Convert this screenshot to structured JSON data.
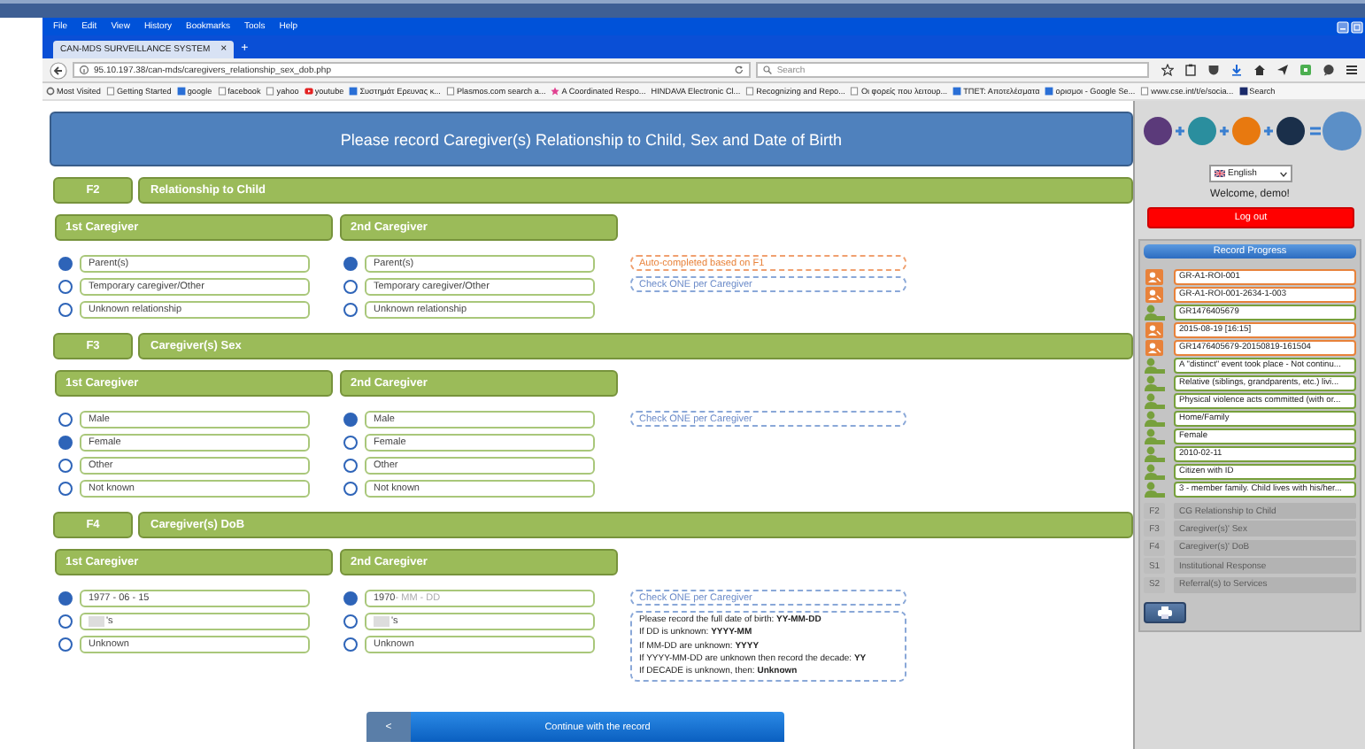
{
  "browser": {
    "menu": [
      "File",
      "Edit",
      "View",
      "History",
      "Bookmarks",
      "Tools",
      "Help"
    ],
    "tab": {
      "title": "CAN-MDS SURVEILLANCE SYSTEM",
      "close": "×"
    },
    "new_tab": "+",
    "url": "95.10.197.38/can-mds/caregivers_relationship_sex_dob.php",
    "search": {
      "placeholder": "Search"
    },
    "bookmarks": [
      {
        "label": "Most Visited",
        "kind": "gear"
      },
      {
        "label": "Getting Started",
        "kind": "page"
      },
      {
        "label": "google",
        "kind": "site"
      },
      {
        "label": "facebook",
        "kind": "page"
      },
      {
        "label": "yahoo",
        "kind": "page"
      },
      {
        "label": "youtube",
        "kind": "video"
      },
      {
        "label": "Συστημάτ Ερευνας κ...",
        "kind": "site"
      },
      {
        "label": "Plasmos.com search a...",
        "kind": "page"
      },
      {
        "label": "A Coordinated Respo...",
        "kind": "star"
      },
      {
        "label": "HINDAVA Electronic Cl...",
        "kind": "plain"
      },
      {
        "label": "Recognizing and Repo...",
        "kind": "page"
      },
      {
        "label": "Οι φορείς που λειτουρ...",
        "kind": "page"
      },
      {
        "label": "ΤΠΕΤ: Αποτελέσματα",
        "kind": "site"
      },
      {
        "label": "ορισμοι - Google Se...",
        "kind": "site"
      },
      {
        "label": "www.cse.int/t/e/socia...",
        "kind": "page"
      },
      {
        "label": "Search",
        "kind": "searchsite"
      }
    ]
  },
  "page": {
    "title": "Please record Caregiver(s) Relationship to Child, Sex and Date of Birth"
  },
  "sections": [
    {
      "code": "F2",
      "title": "Relationship to Child",
      "caregivers": [
        {
          "label": "1st Caregiver",
          "options": [
            {
              "kind": "choice",
              "label": "Parent(s)",
              "selected": true
            },
            {
              "kind": "choice",
              "label": "Temporary caregiver/Other",
              "selected": false
            },
            {
              "kind": "choice",
              "label": "Unknown relationship",
              "selected": false
            }
          ]
        },
        {
          "label": "2nd Caregiver",
          "options": [
            {
              "kind": "choice",
              "label": "Parent(s)",
              "selected": true
            },
            {
              "kind": "choice",
              "label": "Temporary caregiver/Other",
              "selected": false
            },
            {
              "kind": "choice",
              "label": "Unknown relationship",
              "selected": false
            }
          ]
        }
      ],
      "notes": [
        {
          "kind": "auto",
          "text": "Auto-completed based on F1"
        },
        {
          "kind": "hint",
          "text": "Check ONE per Caregiver"
        }
      ]
    },
    {
      "code": "F3",
      "title": "Caregiver(s) Sex",
      "caregivers": [
        {
          "label": "1st Caregiver",
          "options": [
            {
              "kind": "choice",
              "label": "Male",
              "selected": false
            },
            {
              "kind": "choice",
              "label": "Female",
              "selected": true
            },
            {
              "kind": "choice",
              "label": "Other",
              "selected": false
            },
            {
              "kind": "choice",
              "label": "Not known",
              "selected": false
            }
          ]
        },
        {
          "label": "2nd Caregiver",
          "options": [
            {
              "kind": "choice",
              "label": "Male",
              "selected": true
            },
            {
              "kind": "choice",
              "label": "Female",
              "selected": false
            },
            {
              "kind": "choice",
              "label": "Other",
              "selected": false
            },
            {
              "kind": "choice",
              "label": "Not known",
              "selected": false
            }
          ]
        }
      ],
      "notes": [
        {
          "kind": "hint",
          "text": "Check ONE per Caregiver"
        }
      ]
    },
    {
      "code": "F4",
      "title": "Caregiver(s) DoB",
      "caregivers": [
        {
          "label": "1st Caregiver",
          "options": [
            {
              "kind": "date",
              "value": "1977  -  06  -  15",
              "selected": true
            },
            {
              "kind": "decade",
              "value": "'s",
              "selected": false
            },
            {
              "kind": "text",
              "value": "Unknown",
              "selected": false
            }
          ]
        },
        {
          "label": "2nd Caregiver",
          "options": [
            {
              "kind": "date",
              "value": "1970",
              "placeholder": " - MM - DD",
              "selected": true
            },
            {
              "kind": "decade",
              "value": "'s",
              "selected": false
            },
            {
              "kind": "text",
              "value": "Unknown",
              "selected": false
            }
          ]
        }
      ],
      "notes": [
        {
          "kind": "hint",
          "text": "Check ONE per Caregiver"
        },
        {
          "kind": "instructions",
          "lines": [
            "Please record the full date of birth:    **YY-MM-DD**",
            "If DD is unknown:    **YYYY-MM**",
            "If MM-DD are unknown:    **YYYY**",
            "If YYYY-MM-DD are unknown then record the decade:    **YY**",
            "If DECADE is unknown, then:    **Unknown**"
          ]
        }
      ]
    }
  ],
  "buttons": {
    "back": "<",
    "continue": "Continue with the record"
  },
  "sidebar": {
    "language": "English",
    "welcome": "Welcome, demo!",
    "logout": "Log out",
    "progress": {
      "title": "Record Progress",
      "entries": [
        {
          "kind": "auto",
          "color": "#e8823a",
          "value": "GR-A1-ROI-001"
        },
        {
          "kind": "auto",
          "color": "#e8823a",
          "value": "GR-A1-ROI-001-2634-1-003"
        },
        {
          "kind": "manual",
          "color": "#77a03c",
          "value": "GR1476405679"
        },
        {
          "kind": "auto",
          "color": "#e8823a",
          "value": "2015-08-19 [16:15]"
        },
        {
          "kind": "auto",
          "color": "#e8823a",
          "value": "GR1476405679-20150819-161504"
        },
        {
          "kind": "manual",
          "color": "#77a03c",
          "value": "A \"distinct\" event took place - Not continu..."
        },
        {
          "kind": "manual",
          "color": "#77a03c",
          "value": "Relative (siblings, grandparents, etc.) livi..."
        },
        {
          "kind": "manual",
          "color": "#77a03c",
          "value": "Physical violence acts committed (with or..."
        },
        {
          "kind": "manual",
          "color": "#77a03c",
          "value": "Home/Family"
        },
        {
          "kind": "manual",
          "color": "#77a03c",
          "value": "Female"
        },
        {
          "kind": "manual",
          "color": "#77a03c",
          "value": "2010-02-11"
        },
        {
          "kind": "manual",
          "color": "#77a03c",
          "value": "Citizen with ID"
        },
        {
          "kind": "manual",
          "color": "#77a03c",
          "value": "3 - member family. Child lives with his/her..."
        }
      ],
      "pending": [
        {
          "code": "F2",
          "label": "CG Relationship to Child"
        },
        {
          "code": "F3",
          "label": "Caregiver(s)' Sex"
        },
        {
          "code": "F4",
          "label": "Caregiver(s)' DoB"
        },
        {
          "code": "S1",
          "label": "Institutional Response"
        },
        {
          "code": "S2",
          "label": "Referral(s) to Services"
        }
      ]
    }
  }
}
